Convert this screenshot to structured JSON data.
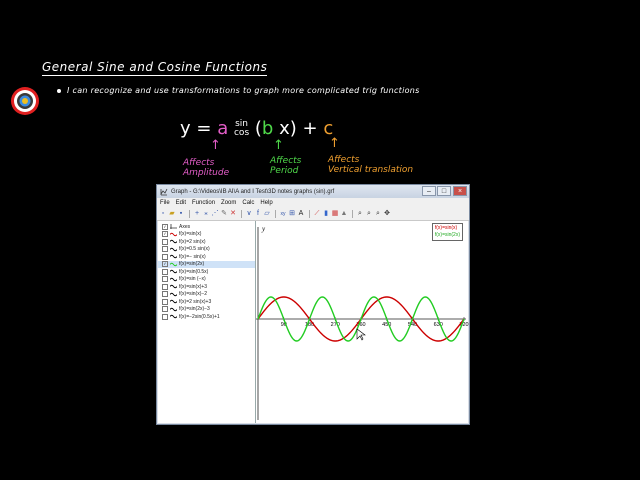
{
  "slide": {
    "title": "General Sine and Cosine Functions",
    "bullet": "I can recognize and use transformations to graph more complicated trig functions",
    "formula": {
      "y": "y",
      "eq": "=",
      "a": "a",
      "sin": "sin",
      "cos": "cos",
      "b": "b",
      "x": "x",
      "plus": "+",
      "c": "c"
    },
    "notes": {
      "a": [
        "Affects",
        "Amplitude"
      ],
      "b": [
        "Affects",
        "Period"
      ],
      "c": [
        "Affects",
        "Vertical translation"
      ]
    },
    "colors": {
      "a": "#e35dc8",
      "b": "#4fd94a",
      "c": "#f0a030"
    }
  },
  "window": {
    "title": "Graph - G:\\Videos\\IB AI\\A and I Test\\3D notes graphs (sin).grf",
    "menu": [
      "File",
      "Edit",
      "Function",
      "Zoom",
      "Calc",
      "Help"
    ],
    "toolbar_icons": [
      "new-file-icon",
      "open-folder-icon",
      "save-icon",
      "insert-function-icon",
      "insert-tangent-icon",
      "insert-point-series-icon",
      "edit-icon",
      "delete-icon",
      "derivative-icon",
      "evaluate-icon",
      "area-icon",
      "text-label-icon",
      "insert-shading-icon",
      "relation-icon",
      "color-icon",
      "zoom-in-icon",
      "zoom-out-icon",
      "zoom-fit-icon",
      "move-icon"
    ],
    "functions": [
      {
        "label": "Axes",
        "checked": true,
        "type": "axes"
      },
      {
        "label": "f(x)=sin(x)",
        "checked": true,
        "color": "#cc0000"
      },
      {
        "label": "f(x)=2 sin(x)",
        "checked": false,
        "color": "#000000"
      },
      {
        "label": "f(x)=0.5 sin(x)",
        "checked": false,
        "color": "#000000"
      },
      {
        "label": "f(x)=− sin(x)",
        "checked": false,
        "color": "#000000"
      },
      {
        "label": "f(x)=sin(2x)",
        "checked": true,
        "color": "#22cc22",
        "selected": true
      },
      {
        "label": "f(x)=sin(0.5x)",
        "checked": false,
        "color": "#000000"
      },
      {
        "label": "f(x)=sin (−x)",
        "checked": false,
        "color": "#000000"
      },
      {
        "label": "f(x)=sin(x)+3",
        "checked": false,
        "color": "#000000"
      },
      {
        "label": "f(x)=sin(x)−2",
        "checked": false,
        "color": "#000000"
      },
      {
        "label": "f(x)=2 sin(x)+3",
        "checked": false,
        "color": "#000000"
      },
      {
        "label": "f(x)=sin(2x)−3",
        "checked": false,
        "color": "#000000"
      },
      {
        "label": "f(x)=−2sin(0.5x)+1",
        "checked": false,
        "color": "#000000"
      }
    ],
    "graph": {
      "y_axis_label": "y",
      "x_ticks": [
        "90",
        "180",
        "270",
        "360",
        "450",
        "540",
        "630",
        "720"
      ],
      "legend": [
        {
          "label": "f(x)=sin(x)",
          "color": "#cc0000"
        },
        {
          "label": "f(x)=sin(2x)",
          "color": "#22cc22"
        }
      ]
    }
  }
}
